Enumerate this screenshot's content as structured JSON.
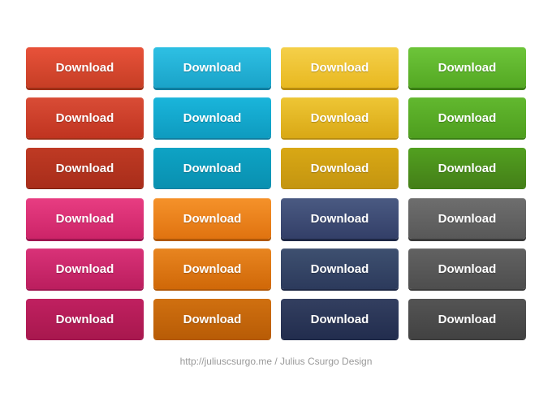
{
  "buttons": {
    "label": "Download"
  },
  "footer": {
    "text": "http://juliuscsurgo.me / Julius Csurgo Design"
  },
  "colors": {
    "red": "#c63e25",
    "cyan": "#1aa3c8",
    "yellow": "#e8b820",
    "green": "#54a823",
    "pink": "#cc2468",
    "orange": "#e07310",
    "navy": "#333f68",
    "gray": "#585858"
  }
}
